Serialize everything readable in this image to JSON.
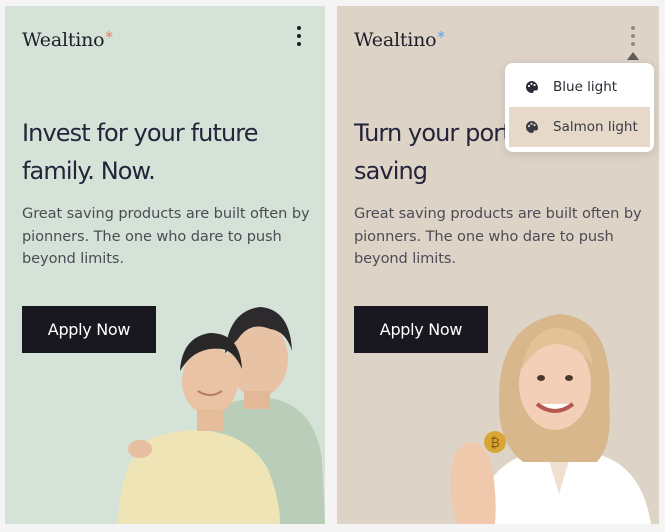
{
  "cards": [
    {
      "brand": "Wealtino",
      "brand_star": "*",
      "star_color": "#f07a5f",
      "headline": "Invest for your future family. Now.",
      "subtext": "Great saving products are built often by pionners. The one who dare to push beyond limits.",
      "cta": "Apply Now",
      "background": "#d4e2d7"
    },
    {
      "brand": "Wealtino",
      "brand_star": "*",
      "star_color": "#4da3f0",
      "headline": "Turn your port pension saving",
      "subtext": "Great saving products are built often by pionners. The one who dare to push beyond limits.",
      "cta": "Apply Now",
      "background": "#ddd3c7"
    }
  ],
  "theme_menu": {
    "items": [
      {
        "label": "Blue light",
        "icon": "palette-icon"
      },
      {
        "label": "Salmon light",
        "icon": "palette-icon",
        "selected": true
      }
    ]
  },
  "colors": {
    "button": "#19171f",
    "text": "#24243a"
  }
}
